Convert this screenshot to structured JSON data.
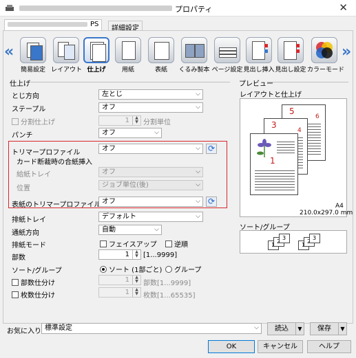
{
  "window": {
    "title": "プロパティ",
    "close": "✕"
  },
  "tabs": [
    {
      "label": "PS"
    },
    {
      "label": "詳細設定"
    }
  ],
  "icon_tabs": [
    {
      "label": "簡易設定",
      "icon": "quick-setup-icon"
    },
    {
      "label": "レイアウト",
      "icon": "layout-icon"
    },
    {
      "label": "仕上げ",
      "icon": "finishing-icon"
    },
    {
      "label": "用紙",
      "icon": "paper-icon"
    },
    {
      "label": "表紙",
      "icon": "cover-icon"
    },
    {
      "label": "くるみ製本",
      "icon": "perfect-binding-icon"
    },
    {
      "label": "ページ設定",
      "icon": "page-setup-icon"
    },
    {
      "label": "見出し挿入",
      "icon": "tab-insert-icon"
    },
    {
      "label": "見出し設定",
      "icon": "tab-settings-icon"
    },
    {
      "label": "カラーモード",
      "icon": "color-mode-icon"
    }
  ],
  "finishing": {
    "group_title": "仕上げ",
    "binding_dir": {
      "label": "とじ方向",
      "value": "左とじ"
    },
    "staple": {
      "label": "ステープル",
      "value": "オフ"
    },
    "split": {
      "label": "分割仕上げ",
      "value": "1",
      "unit": "分割単位"
    },
    "punch": {
      "label": "パンチ",
      "value": "オフ"
    },
    "trimmer": {
      "label": "トリマープロファイル",
      "value": "オフ"
    },
    "card_insert": {
      "label": "カード断裁時の合紙挿入"
    },
    "feed_tray": {
      "label": "給紙トレイ",
      "value": "オフ"
    },
    "position": {
      "label": "位置",
      "value": "ジョブ単位(後)"
    },
    "cover_trimmer": {
      "label": "表紙のトリマープロファイル",
      "value": "オフ"
    }
  },
  "output": {
    "output_tray": {
      "label": "排紙トレイ",
      "value": "デフォルト"
    },
    "feed_direction": {
      "label": "通紙方向",
      "value": "自動"
    },
    "output_mode": {
      "label": "排紙モード",
      "face_up": "フェイスアップ",
      "reverse": "逆順"
    },
    "copies": {
      "label": "部数",
      "value": "1",
      "range": "[1...9999]"
    },
    "sort": {
      "label": "ソート/グループ",
      "sort": "ソート (1部ごと)",
      "group": "グループ"
    },
    "set_separation": {
      "label": "部数仕分け",
      "value": "1",
      "hint": "部数[1...9999]"
    },
    "sheet_separation": {
      "label": "枚数仕分け",
      "value": "1",
      "hint": "枚数[1...65535]"
    }
  },
  "preview": {
    "group_title": "プレビュー",
    "subtitle": "レイアウトと仕上げ",
    "page_numbers": [
      "5",
      "6",
      "3",
      "4",
      "1"
    ],
    "paper_size": "A4",
    "paper_dims": "210.0x297.0 mm",
    "sort_title": "ソート/グループ",
    "sort_pages": [
      "1",
      "2",
      "3",
      "1",
      "2",
      "3"
    ]
  },
  "favorites": {
    "label": "お気に入り",
    "value": "標準設定",
    "load": "読込",
    "save": "保存"
  },
  "buttons": {
    "ok": "OK",
    "cancel": "キャンセル",
    "help": "ヘルプ"
  }
}
